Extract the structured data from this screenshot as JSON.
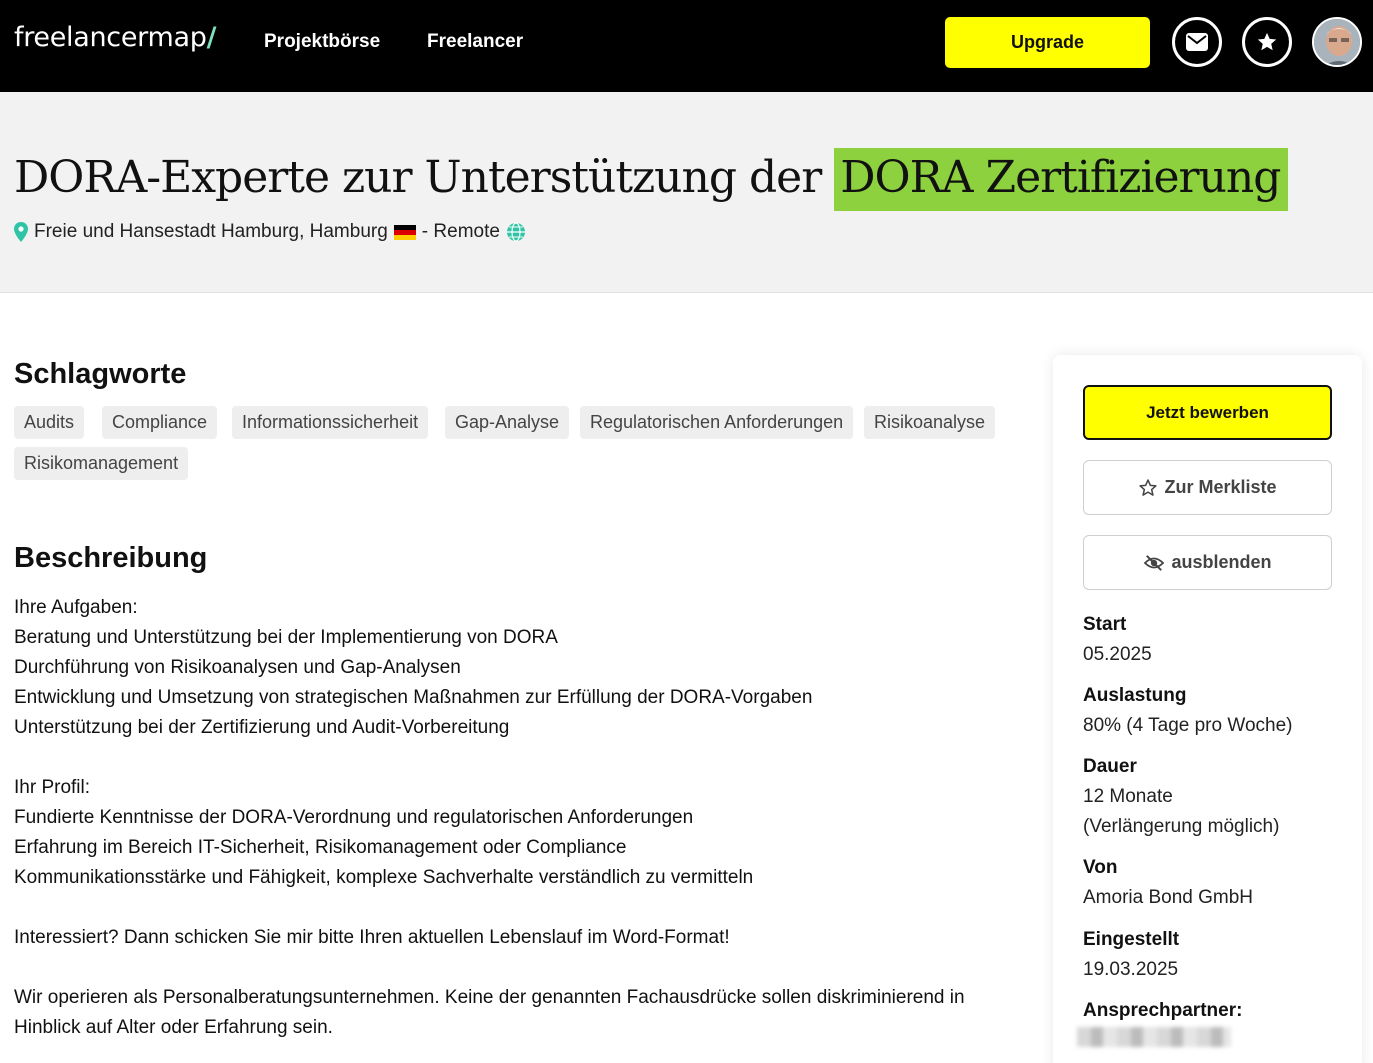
{
  "nav": {
    "logo": "freelancermap",
    "logo_slash": "/",
    "projektboerse": "Projektbörse",
    "freelancer": "Freelancer",
    "upgrade": "Upgrade",
    "icons": [
      "envelope-icon",
      "star-icon"
    ],
    "accent": "#ffff00"
  },
  "project": {
    "title_main": "DORA-Experte zur Unterstützung der",
    "title_highlight": "DORA Zertifizierung",
    "highlight_color": "#8dd13f",
    "location": "Freie und Hansestadt Hamburg, Hamburg",
    "remote": "- Remote"
  },
  "keywords": {
    "heading": "Schlagworte",
    "tags": [
      "Audits",
      "Compliance",
      "Informationssicherheit",
      "Gap-Analyse",
      "Regulatorischen Anforderungen",
      "Risikoanalyse",
      "Risikomanagement"
    ]
  },
  "description": {
    "heading": "Beschreibung",
    "lines": [
      "Ihre Aufgaben:",
      "Beratung und Unterstützung bei der Implementierung von DORA",
      "Durchführung von Risikoanalysen und Gap-Analysen",
      "Entwicklung und Umsetzung von strategischen Maßnahmen zur Erfüllung der DORA-Vorgaben",
      "Unterstützung bei der Zertifizierung und Audit-Vorbereitung",
      "",
      "Ihr Profil:",
      "Fundierte Kenntnisse der DORA-Verordnung und regulatorischen Anforderungen",
      "Erfahrung im Bereich IT-Sicherheit, Risikomanagement oder Compliance",
      "Kommunikationsstärke und Fähigkeit, komplexe Sachverhalte verständlich zu vermitteln",
      "",
      "Interessiert? Dann schicken Sie mir bitte Ihren aktuellen Lebenslauf im Word-Format!",
      "",
      "Wir operieren als Personalberatungsunternehmen. Keine der genannten Fachausdrücke sollen diskriminierend in Hinblick auf Alter oder Erfahrung sein."
    ]
  },
  "sidebar": {
    "apply": "Jetzt bewerben",
    "watchlist": "Zur Merkliste",
    "hide": "ausblenden",
    "start_label": "Start",
    "start_value": "05.2025",
    "load_label": "Auslastung",
    "load_value": "80% (4 Tage pro Woche)",
    "duration_label": "Dauer",
    "duration_value": "12 Monate",
    "duration_note": "(Verlängerung möglich)",
    "from_label": "Von",
    "from_value": "Amoria Bond GmbH",
    "posted_label": "Eingestellt",
    "posted_value": "19.03.2025",
    "contact_label": "Ansprechpartner:"
  }
}
